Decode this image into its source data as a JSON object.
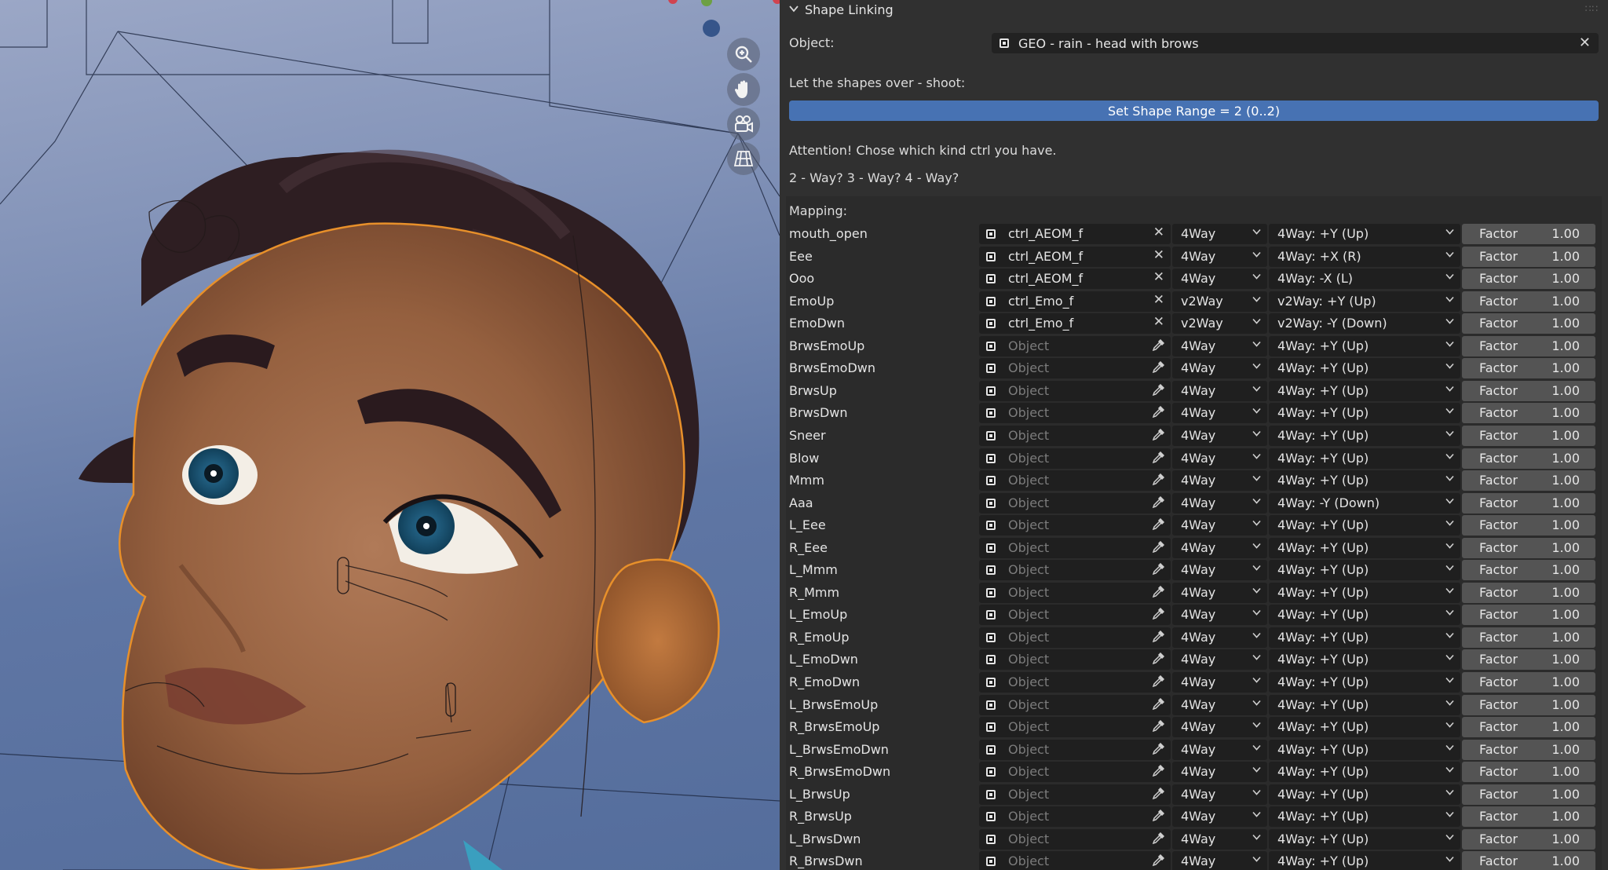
{
  "colors": {
    "accent_button": "#4772b3",
    "panel_bg": "#303030",
    "field_bg": "#1f1f1f",
    "outline_orange": "#e8902a"
  },
  "viewport": {
    "nav_icons": [
      "zoom-icon",
      "hand-pan-icon",
      "camera-icon",
      "grid-perspective-icon"
    ]
  },
  "panel": {
    "title": "Shape Linking",
    "object_label": "Object:",
    "object_value": "GEO - rain - head with brows",
    "overshoot_label": "Let the shapes over - shoot:",
    "set_range_button": "Set Shape Range = 2 (0..2)",
    "attention_text": "Attention! Chose which kind ctrl you have.",
    "way_text": "2 - Way? 3 - Way? 4 - Way?",
    "mapping_label": "Mapping:"
  },
  "mapping_rows": [
    {
      "name": "mouth_open",
      "object": "ctrl_AEOM_f",
      "set": true,
      "way": "4Way",
      "direction": "4Way: +Y (Up)",
      "factor_label": "Factor",
      "factor": "1.00"
    },
    {
      "name": "Eee",
      "object": "ctrl_AEOM_f",
      "set": true,
      "way": "4Way",
      "direction": "4Way: +X (R)",
      "factor_label": "Factor",
      "factor": "1.00"
    },
    {
      "name": "Ooo",
      "object": "ctrl_AEOM_f",
      "set": true,
      "way": "4Way",
      "direction": "4Way: -X (L)",
      "factor_label": "Factor",
      "factor": "1.00"
    },
    {
      "name": "EmoUp",
      "object": "ctrl_Emo_f",
      "set": true,
      "way": "v2Way",
      "direction": "v2Way: +Y (Up)",
      "factor_label": "Factor",
      "factor": "1.00"
    },
    {
      "name": "EmoDwn",
      "object": "ctrl_Emo_f",
      "set": true,
      "way": "v2Way",
      "direction": "v2Way: -Y (Down)",
      "factor_label": "Factor",
      "factor": "1.00"
    },
    {
      "name": "BrwsEmoUp",
      "object": "Object",
      "set": false,
      "way": "4Way",
      "direction": "4Way: +Y (Up)",
      "factor_label": "Factor",
      "factor": "1.00"
    },
    {
      "name": "BrwsEmoDwn",
      "object": "Object",
      "set": false,
      "way": "4Way",
      "direction": "4Way: +Y (Up)",
      "factor_label": "Factor",
      "factor": "1.00"
    },
    {
      "name": "BrwsUp",
      "object": "Object",
      "set": false,
      "way": "4Way",
      "direction": "4Way: +Y (Up)",
      "factor_label": "Factor",
      "factor": "1.00"
    },
    {
      "name": "BrwsDwn",
      "object": "Object",
      "set": false,
      "way": "4Way",
      "direction": "4Way: +Y (Up)",
      "factor_label": "Factor",
      "factor": "1.00"
    },
    {
      "name": "Sneer",
      "object": "Object",
      "set": false,
      "way": "4Way",
      "direction": "4Way: +Y (Up)",
      "factor_label": "Factor",
      "factor": "1.00"
    },
    {
      "name": "Blow",
      "object": "Object",
      "set": false,
      "way": "4Way",
      "direction": "4Way: +Y (Up)",
      "factor_label": "Factor",
      "factor": "1.00"
    },
    {
      "name": "Mmm",
      "object": "Object",
      "set": false,
      "way": "4Way",
      "direction": "4Way: +Y (Up)",
      "factor_label": "Factor",
      "factor": "1.00"
    },
    {
      "name": "Aaa",
      "object": "Object",
      "set": false,
      "way": "4Way",
      "direction": "4Way: -Y (Down)",
      "factor_label": "Factor",
      "factor": "1.00"
    },
    {
      "name": "L_Eee",
      "object": "Object",
      "set": false,
      "way": "4Way",
      "direction": "4Way: +Y (Up)",
      "factor_label": "Factor",
      "factor": "1.00"
    },
    {
      "name": "R_Eee",
      "object": "Object",
      "set": false,
      "way": "4Way",
      "direction": "4Way: +Y (Up)",
      "factor_label": "Factor",
      "factor": "1.00"
    },
    {
      "name": "L_Mmm",
      "object": "Object",
      "set": false,
      "way": "4Way",
      "direction": "4Way: +Y (Up)",
      "factor_label": "Factor",
      "factor": "1.00"
    },
    {
      "name": "R_Mmm",
      "object": "Object",
      "set": false,
      "way": "4Way",
      "direction": "4Way: +Y (Up)",
      "factor_label": "Factor",
      "factor": "1.00"
    },
    {
      "name": "L_EmoUp",
      "object": "Object",
      "set": false,
      "way": "4Way",
      "direction": "4Way: +Y (Up)",
      "factor_label": "Factor",
      "factor": "1.00"
    },
    {
      "name": "R_EmoUp",
      "object": "Object",
      "set": false,
      "way": "4Way",
      "direction": "4Way: +Y (Up)",
      "factor_label": "Factor",
      "factor": "1.00"
    },
    {
      "name": "L_EmoDwn",
      "object": "Object",
      "set": false,
      "way": "4Way",
      "direction": "4Way: +Y (Up)",
      "factor_label": "Factor",
      "factor": "1.00"
    },
    {
      "name": "R_EmoDwn",
      "object": "Object",
      "set": false,
      "way": "4Way",
      "direction": "4Way: +Y (Up)",
      "factor_label": "Factor",
      "factor": "1.00"
    },
    {
      "name": "L_BrwsEmoUp",
      "object": "Object",
      "set": false,
      "way": "4Way",
      "direction": "4Way: +Y (Up)",
      "factor_label": "Factor",
      "factor": "1.00"
    },
    {
      "name": "R_BrwsEmoUp",
      "object": "Object",
      "set": false,
      "way": "4Way",
      "direction": "4Way: +Y (Up)",
      "factor_label": "Factor",
      "factor": "1.00"
    },
    {
      "name": "L_BrwsEmoDwn",
      "object": "Object",
      "set": false,
      "way": "4Way",
      "direction": "4Way: +Y (Up)",
      "factor_label": "Factor",
      "factor": "1.00"
    },
    {
      "name": "R_BrwsEmoDwn",
      "object": "Object",
      "set": false,
      "way": "4Way",
      "direction": "4Way: +Y (Up)",
      "factor_label": "Factor",
      "factor": "1.00"
    },
    {
      "name": "L_BrwsUp",
      "object": "Object",
      "set": false,
      "way": "4Way",
      "direction": "4Way: +Y (Up)",
      "factor_label": "Factor",
      "factor": "1.00"
    },
    {
      "name": "R_BrwsUp",
      "object": "Object",
      "set": false,
      "way": "4Way",
      "direction": "4Way: +Y (Up)",
      "factor_label": "Factor",
      "factor": "1.00"
    },
    {
      "name": "L_BrwsDwn",
      "object": "Object",
      "set": false,
      "way": "4Way",
      "direction": "4Way: +Y (Up)",
      "factor_label": "Factor",
      "factor": "1.00"
    },
    {
      "name": "R_BrwsDwn",
      "object": "Object",
      "set": false,
      "way": "4Way",
      "direction": "4Way: +Y (Up)",
      "factor_label": "Factor",
      "factor": "1.00"
    }
  ]
}
